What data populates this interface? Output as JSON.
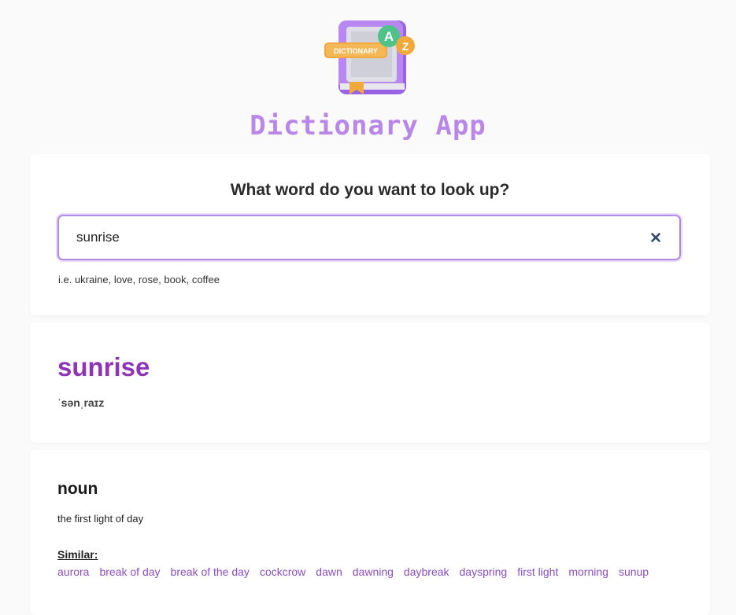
{
  "app": {
    "title": "Dictionary App",
    "logo": {
      "label": "DICTIONARY",
      "letter_a": "A",
      "letter_z": "Z"
    }
  },
  "search": {
    "heading": "What word do you want to look up?",
    "value": "sunrise",
    "hint": "i.e. ukraine, love, rose, book, coffee"
  },
  "entry": {
    "word": "sunrise",
    "phonetic": "ˈsənˌraɪz",
    "meanings": [
      {
        "part_of_speech": "noun",
        "definition": "the first light of day",
        "similar_label": "Similar:",
        "synonyms": [
          "aurora",
          "break of day",
          "break of the day",
          "cockcrow",
          "dawn",
          "dawning",
          "daybreak",
          "dayspring",
          "first light",
          "morning",
          "sunup"
        ]
      }
    ]
  },
  "colors": {
    "accent": "#b887e8",
    "word": "#8f33b8",
    "synonym": "#8b4ec2"
  }
}
